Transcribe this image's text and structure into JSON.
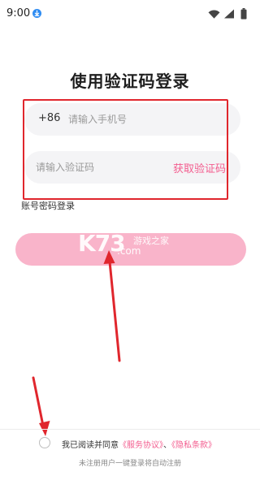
{
  "status_bar": {
    "time": "9:00",
    "icons": [
      "download-icon",
      "wifi-icon",
      "signal-icon",
      "battery-icon"
    ]
  },
  "login": {
    "title": "使用验证码登录",
    "phone": {
      "country_code": "+86",
      "placeholder": "请输入手机号"
    },
    "code": {
      "placeholder": "请输入验证码",
      "get_code_label": "获取验证码"
    },
    "password_login_label": "账号密码登录",
    "login_button_label": ""
  },
  "watermark": {
    "text": "K73",
    "name": "游戏之家",
    "domain": ".com"
  },
  "agreement": {
    "prefix": "我已阅读并同意",
    "service_link": "《服务协议》",
    "separator": "、",
    "privacy_link": "《隐私条款》",
    "checked": false
  },
  "footer": {
    "register_hint": "未注册用户一键登录将自动注册"
  },
  "colors": {
    "accent": "#f35d8f",
    "button": "#f9b4ca",
    "annotation": "#e0262d",
    "field_bg": "#f4f4f6"
  }
}
